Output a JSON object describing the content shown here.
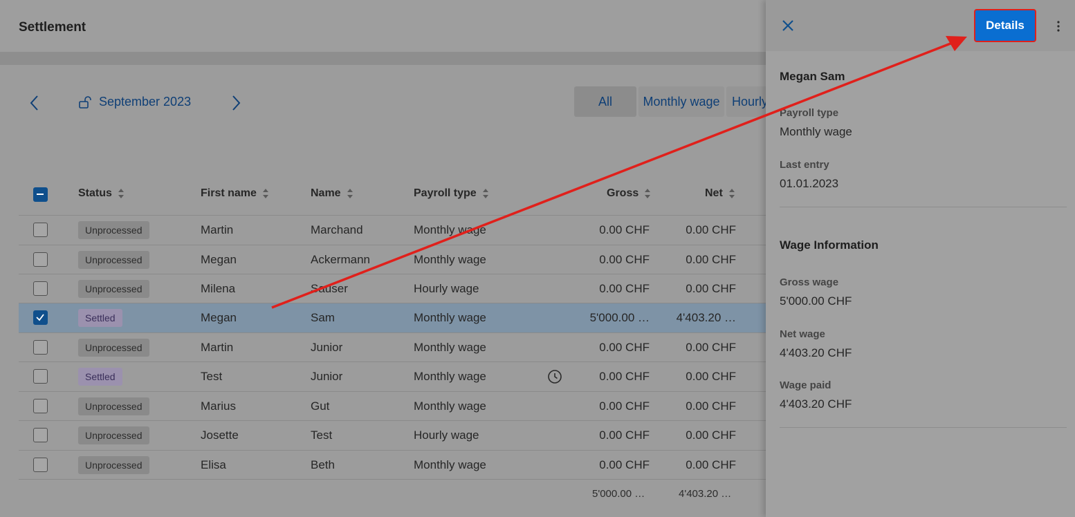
{
  "header": {
    "title": "Settlement"
  },
  "period": {
    "label": "September 2023"
  },
  "filters": {
    "all": "All",
    "monthly": "Monthly wage",
    "hourly": "Hourly"
  },
  "table": {
    "columns": {
      "status": "Status",
      "first_name": "First name",
      "name": "Name",
      "payroll_type": "Payroll type",
      "gross": "Gross",
      "net": "Net"
    },
    "rows": [
      {
        "status": "Unprocessed",
        "first_name": "Martin",
        "name": "Marchand",
        "payroll_type": "Monthly wage",
        "gross": "0.00 CHF",
        "net": "0.00 CHF",
        "checked": false
      },
      {
        "status": "Unprocessed",
        "first_name": "Megan",
        "name": "Ackermann",
        "payroll_type": "Monthly wage",
        "gross": "0.00 CHF",
        "net": "0.00 CHF",
        "checked": false
      },
      {
        "status": "Unprocessed",
        "first_name": "Milena",
        "name": "Sauser",
        "payroll_type": "Hourly wage",
        "gross": "0.00 CHF",
        "net": "0.00 CHF",
        "checked": false
      },
      {
        "status": "Settled",
        "first_name": "Megan",
        "name": "Sam",
        "payroll_type": "Monthly wage",
        "gross": "5'000.00 …",
        "net": "4'403.20 …",
        "checked": true
      },
      {
        "status": "Unprocessed",
        "first_name": "Martin",
        "name": "Junior",
        "payroll_type": "Monthly wage",
        "gross": "0.00 CHF",
        "net": "0.00 CHF",
        "checked": false
      },
      {
        "status": "Settled",
        "first_name": "Test",
        "name": "Junior",
        "payroll_type": "Monthly wage",
        "gross": "0.00 CHF",
        "net": "0.00 CHF",
        "checked": false
      },
      {
        "status": "Unprocessed",
        "first_name": "Marius",
        "name": "Gut",
        "payroll_type": "Monthly wage",
        "gross": "0.00 CHF",
        "net": "0.00 CHF",
        "checked": false
      },
      {
        "status": "Unprocessed",
        "first_name": "Josette",
        "name": "Test",
        "payroll_type": "Hourly wage",
        "gross": "0.00 CHF",
        "net": "0.00 CHF",
        "checked": false
      },
      {
        "status": "Unprocessed",
        "first_name": "Elisa",
        "name": "Beth",
        "payroll_type": "Monthly wage",
        "gross": "0.00 CHF",
        "net": "0.00 CHF",
        "checked": false
      }
    ],
    "totals": {
      "gross": "5'000.00 …",
      "net": "4'403.20 …"
    }
  },
  "drawer": {
    "details_label": "Details",
    "employee_name": "Megan Sam",
    "payroll_type_label": "Payroll type",
    "payroll_type_value": "Monthly wage",
    "last_entry_label": "Last entry",
    "last_entry_value": "01.01.2023",
    "wage_info_heading": "Wage Information",
    "gross_label": "Gross wage",
    "gross_value": "5'000.00 CHF",
    "net_label": "Net wage",
    "net_value": "4'403.20 CHF",
    "paid_label": "Wage paid",
    "paid_value": "4'403.20 CHF"
  },
  "colors": {
    "accent": "#0a6ed1",
    "annotation_arrow": "#e0201b",
    "link": "#0f3f76"
  }
}
